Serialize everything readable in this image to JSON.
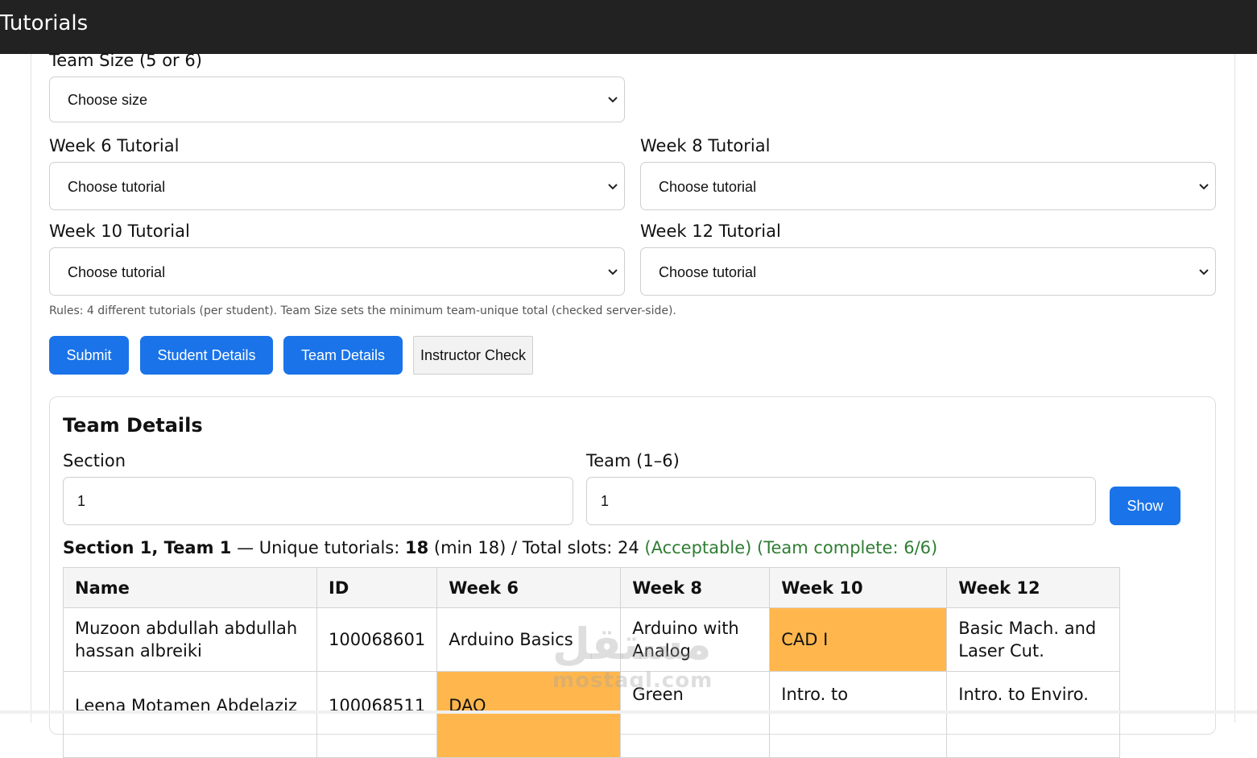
{
  "app": {
    "title": "Tutorials"
  },
  "form": {
    "team_size": {
      "label": "Team Size (5 or 6)",
      "value": "Choose size"
    },
    "week6": {
      "label": "Week 6 Tutorial",
      "value": "Choose tutorial"
    },
    "week8": {
      "label": "Week 8 Tutorial",
      "value": "Choose tutorial"
    },
    "week10": {
      "label": "Week 10 Tutorial",
      "value": "Choose tutorial"
    },
    "week12": {
      "label": "Week 12 Tutorial",
      "value": "Choose tutorial"
    },
    "rules": "Rules: 4 different tutorials (per student). Team Size sets the minimum team-unique total (checked server-side)."
  },
  "buttons": {
    "submit": "Submit",
    "student_details": "Student Details",
    "team_details": "Team Details",
    "instructor_check": "Instructor Check"
  },
  "team_panel": {
    "title": "Team Details",
    "section": {
      "label": "Section",
      "value": "1"
    },
    "team": {
      "label": "Team (1–6)",
      "value": "1"
    },
    "show_button": "Show",
    "summary": {
      "heading": "Section 1, Team 1",
      "unique_prefix": " — Unique tutorials: ",
      "unique_count": "18",
      "rest": " (min 18) / Total slots: 24 ",
      "acceptable": "(Acceptable)",
      "complete": "(Team complete: 6/6)"
    },
    "table": {
      "headers": [
        "Name",
        "ID",
        "Week 6",
        "Week 8",
        "Week 10",
        "Week 12"
      ],
      "rows": [
        {
          "name": "Muzoon abdullah abdullah hassan albreiki",
          "id": "100068601",
          "week6": "Arduino Basics",
          "week8": "Arduino with Analog",
          "week10": "CAD I",
          "week12": "Basic Mach. and Laser Cut."
        },
        {
          "name": "Leena Motamen Abdelaziz",
          "id": "100068511",
          "week6": "DAQ",
          "week8": "Green",
          "week10": "Intro. to",
          "week12": "Intro. to Enviro."
        }
      ]
    }
  },
  "colors": {
    "topbar": "#222222",
    "primary": "#1a73e8",
    "highlight": "#ffb74d",
    "ok_text": "#2e7d32"
  },
  "watermark": {
    "ar": "مستقل",
    "en": "mostaql.com"
  }
}
